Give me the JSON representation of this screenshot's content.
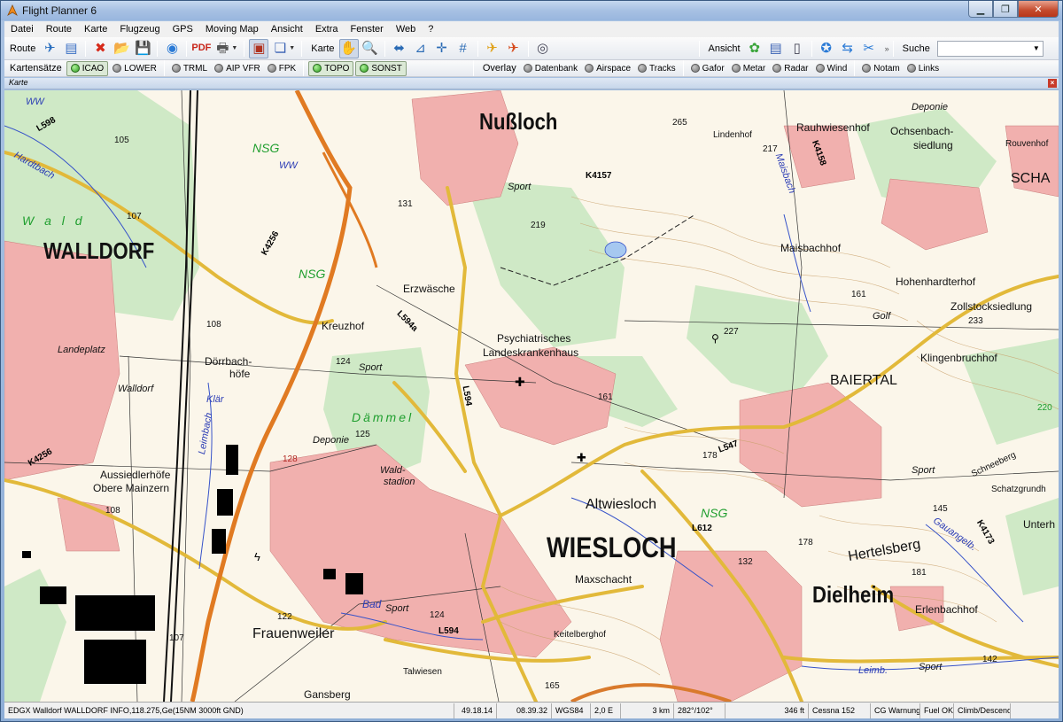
{
  "window": {
    "title": "Flight Planner 6"
  },
  "menu": [
    "Datei",
    "Route",
    "Karte",
    "Flugzeug",
    "GPS",
    "Moving Map",
    "Ansicht",
    "Extra",
    "Fenster",
    "Web",
    "?"
  ],
  "toolbar": {
    "route_label": "Route",
    "karte_label": "Karte",
    "ansicht_label": "Ansicht",
    "search_label": "Suche",
    "search_value": ""
  },
  "chart_sets": {
    "label": "Kartensätze",
    "items": [
      {
        "label": "ICAO",
        "on": true
      },
      {
        "label": "LOWER",
        "on": false
      },
      {
        "label": "TRML",
        "on": false
      },
      {
        "label": "AIP VFR",
        "on": false
      },
      {
        "label": "FPK",
        "on": false
      },
      {
        "label": "TOPO",
        "on": true
      },
      {
        "label": "SONST",
        "on": true
      }
    ]
  },
  "overlay": {
    "label": "Overlay",
    "items": [
      "Datenbank",
      "Airspace",
      "Tracks",
      "Gafor",
      "Metar",
      "Radar",
      "Wind",
      "Notam",
      "Links"
    ]
  },
  "map_panel": {
    "title": "Karte"
  },
  "map_labels": {
    "nussloch": "Nußloch",
    "walldorf": "WALLDORF",
    "wiesloch": "WIESLOCH",
    "dielheim": "Dielheim",
    "baiertal": "BAIERTAL",
    "altwiesloch": "Altwiesloch",
    "frauenweiler": "Frauenweiler",
    "kreuzhof": "Kreuzhof",
    "erzwasche": "Erzwäsche",
    "psych1": "Psychiatrisches",
    "psych2": "Landeskrankenhaus",
    "landeplatz": "Landeplatz",
    "walldorf_small": "Walldorf",
    "dorrbach": "Dörrbach-",
    "hofe": "höfe",
    "aussiedlerhofe": "Aussiedlerhöfe",
    "obere_mainzern": "Obere Mainzern",
    "maxschacht": "Maxschacht",
    "hertelsberg": "Hertelsberg",
    "erlenbachhof": "Erlenbachhof",
    "maisbachhof": "Maisbachhof",
    "hohenhardterhof": "Hohenhardterhof",
    "zollstock": "Zollstocksiedlung",
    "klingenbruchhof": "Klingenbruchhof",
    "ochsenbach1": "Ochsenbach-",
    "ochsenbach2": "siedlung",
    "rauhwiesenhof": "Rauhwiesenhof",
    "lindenhof": "Lindenhof",
    "rouvenhof": "Rouvenhof",
    "schatz": "SCHA",
    "deponie1": "Deponie",
    "deponie2": "Deponie",
    "schatzgrund": "Schatzgrundh",
    "unterh": "Unterh",
    "schneeberg": "Schneeberg",
    "keitelberghof": "Keitelberghof",
    "talwiesen": "Talwiesen",
    "gansberg": "Gansberg",
    "waldstadion1": "Wald-",
    "waldstadion2": "stadion",
    "dammel": "Dämmel",
    "wald": "W a l d",
    "nsg1": "NSG",
    "nsg2": "NSG",
    "nsg3": "NSG",
    "ww1": "WW",
    "ww2": "WW",
    "hardtbach": "Hardtbach",
    "klar": "Klär",
    "leimbach": "Leimbach",
    "leimb": "Leimb.",
    "maisbach": "Maisbach",
    "gauangelb": "Gauangelb.",
    "golf": "Golf",
    "sport1": "Sport",
    "sport2": "Sport",
    "sport3": "Sport",
    "sport4": "Sport",
    "sport5": "Sport",
    "bad": "Bad",
    "l598": "L598",
    "l594a": "L594a",
    "l594": "L594",
    "l594b": "L594",
    "l547": "L547",
    "l612": "L612",
    "k4157": "K4157",
    "k4158": "K4158",
    "k4256a": "K4256",
    "k4256b": "K4256",
    "k4173": "K4173",
    "e105": "105",
    "e107": "107",
    "e108a": "108",
    "e108b": "108",
    "e131": "131",
    "e124a": "124",
    "e124b": "124",
    "e125": "125",
    "e128": "128",
    "e265": "265",
    "e217": "217",
    "e219": "219",
    "e227": "227",
    "e161a": "161",
    "e161b": "161",
    "e233": "233",
    "e178a": "178",
    "e178b": "178",
    "e145": "145",
    "e132": "132",
    "e181": "181",
    "e142": "142",
    "e165": "165",
    "e122": "122",
    "e107b": "107",
    "e220": "220"
  },
  "status": {
    "info": "EDGX Walldorf WALLDORF INFO,118.275,Ge(15NM 3000ft GND)",
    "lat": "49.18.14",
    "lon": "08.39.32",
    "datum": "WGS84",
    "var": "2,0 E",
    "dist": "3 km",
    "bearing": "282°/102°",
    "elev": "346 ft",
    "aircraft": "Cessna 152",
    "cg": "CG Warnung",
    "fuel": "Fuel OK",
    "climb": "Climb/Descend"
  }
}
